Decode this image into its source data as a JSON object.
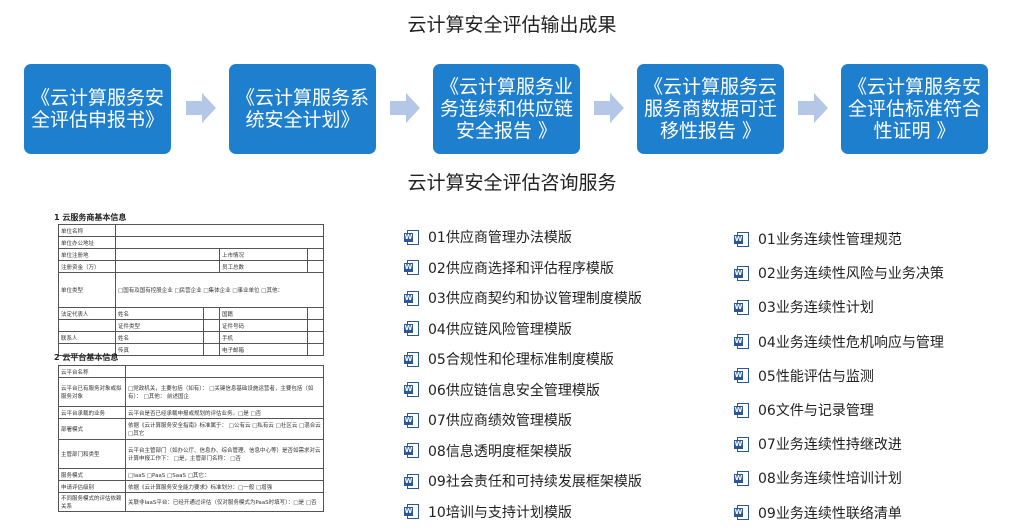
{
  "top_title": "云计算安全评估输出成果",
  "flow_steps": [
    "《云计算服务安全评估申报书》",
    "《云计算服务系统安全计划》",
    "《云计算服务业务连续和供应链安全报告 》",
    "《云计算服务云服务商数据可迁移性报告 》",
    "《云计算服务安全评估标准符合性证明 》"
  ],
  "mid_title": "云计算安全评估咨询服务",
  "colors": {
    "step_fill": "#1f7fcf",
    "arrow_fill": "#b4c7e7",
    "word_icon": "#2b5797"
  },
  "icon": "word-document-icon",
  "document": {
    "section1": "1 云服务商基本信息",
    "section1_rows": [
      [
        "单位名称",
        ""
      ],
      [
        "单位办公地址",
        ""
      ],
      [
        "单位注册地",
        "",
        "上市情况",
        ""
      ],
      [
        "注册资金（万）",
        "",
        "员工总数",
        ""
      ],
      [
        "单位类型",
        "□国有及国有控股企业  □民营企业  □集体企业  □事业单位  □其他："
      ],
      [
        "法定代表人",
        "姓名",
        "",
        "国籍",
        ""
      ],
      [
        "",
        "证件类型",
        "",
        "证件号码",
        ""
      ],
      [
        "联系人",
        "姓名",
        "",
        "手机",
        ""
      ],
      [
        "",
        "传真",
        "",
        "电子邮箱",
        ""
      ]
    ],
    "section2": "2 云平台基本信息",
    "section2_rows": [
      [
        "云平台名称",
        ""
      ],
      [
        "云平台已有服务对象或拟服务对象",
        "□党政机关，主要包括（如有）：  □关键信息基础设施运营者，主要包括（如有）：  □其他：   前述国企"
      ],
      [
        "云平台承载的业务",
        "云平台是否已经承载申报或规划的评估业务。□是  □否"
      ],
      [
        "部署模式",
        "依据《云计算服务安全指南》标准属于：  □公有云  □私有云  □社区云  □混合云  □其它"
      ],
      [
        "主管部门和类型",
        "云平台主管部门（如办公厅、信息办、综合管理、信息中心等）是否如需求对云计算申报工作下：  □是，主管部门名称：  □否"
      ],
      [
        "服务模式",
        "□IaaS  □PaaS  □SaaS  □其它："
      ],
      [
        "申请评估级别",
        "依据《云计算服务安全能力要求》标准划分：□一般  □增强"
      ],
      [
        "不同服务模式的评估依赖关系",
        "关联非IaaS平台：已经开通过评估（仅对服务模式为PaaS时填写）：□是  □否"
      ]
    ]
  },
  "list_left": [
    "01供应商管理办法模版",
    "02供应商选择和评估程序模版",
    "03供应商契约和协议管理制度模版",
    "04供应链风险管理模版",
    "05合规性和伦理标准制度模版",
    "06供应链信息安全管理模版",
    "07供应商绩效管理模版",
    "08信息透明度框架模版",
    "09社会责任和可持续发展框架模版",
    "10培训与支持计划模版"
  ],
  "list_right": [
    "01业务连续性管理规范",
    "02业务连续性风险与业务决策",
    "03业务连续性计划",
    "04业务连续性危机响应与管理",
    "05性能评估与监测",
    "06文件与记录管理",
    "07业务连续性持继改进",
    "08业务连续性培训计划",
    "09业务连续性联络清单"
  ]
}
